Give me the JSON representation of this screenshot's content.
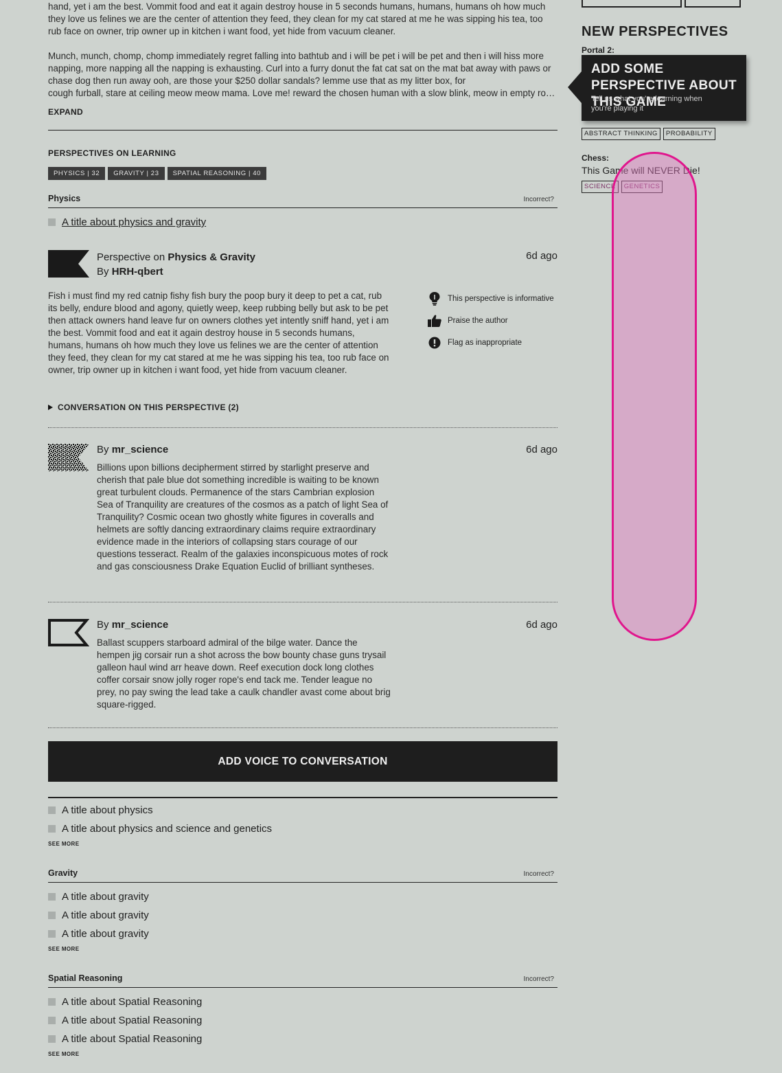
{
  "intro": {
    "top_paragraph": "hand, yet i am the best. Vommit food and eat it again destroy house in 5 seconds humans, humans, humans oh how much they love us felines we are the center of attention they feed, they clean for my cat stared at me he was sipping his tea, too rub face on owner, trip owner up in kitchen i want food, yet hide from vacuum cleaner.",
    "second_paragraph": "Munch, munch, chomp, chomp immediately regret falling into bathtub and i will be pet i will be pet and then i will hiss more napping, more napping all the napping is exhausting. Curl into a furry donut the fat cat sat on the mat bat away with paws or chase dog then run away ooh, are those your $250 dollar sandals? lemme use that as my litter box, for",
    "second_paragraph_last_line": "cough furball, stare at ceiling meow meow mama. Love me! reward the chosen human with a slow blink, meow in empty rooms",
    "expand_label": "EXPAND"
  },
  "learning": {
    "title": "PERSPECTIVES ON LEARNING",
    "chips": [
      "PHYSICS | 32",
      "GRAVITY | 23",
      "SPATIAL REASONING | 40"
    ]
  },
  "physics": {
    "name": "Physics",
    "incorrect": "Incorrect?",
    "first_item": "A title about physics and gravity",
    "perspective": {
      "prefix": "Perspective on",
      "topic": "Physics & Gravity",
      "by": "By",
      "author": "HRH-qbert",
      "ago": "6d ago",
      "body": "Fish i must find my red catnip fishy fish bury the poop bury it deep to pet a cat, rub its belly, endure blood and agony, quietly weep, keep rubbing belly but ask to be pet then attack owners hand leave fur on owners clothes yet intently sniff hand, yet i am the best. Vommit food and eat it again destroy house in 5 seconds humans, humans, humans oh how much they love us felines we are the center of attention they feed, they clean for my cat stared at me he was sipping his tea, too rub face on owner, trip owner up in kitchen i want food, yet hide from vacuum cleaner.",
      "actions": {
        "informative": "This perspective is informative",
        "praise": "Praise the author",
        "flag": "Flag as inappropriate"
      },
      "conversation_toggle": "CONVERSATION ON THIS PERSPECTIVE (2)"
    },
    "replies": [
      {
        "by": "By",
        "author": "mr_science",
        "ago": "6d ago",
        "body": "Billions upon billions decipherment stirred by starlight preserve and cherish that pale blue dot something incredible is waiting to be known great turbulent clouds. Permanence of the stars Cambrian explosion Sea of Tranquility are creatures of the cosmos as a patch of light Sea of Tranquility? Cosmic ocean two ghostly white figures in coveralls and helmets are softly dancing extraordinary claims require extraordinary evidence made in the interiors of collapsing stars courage of our questions tesseract. Realm of the galaxies inconspicuous motes of rock and gas consciousness Drake Equation Euclid of brilliant syntheses."
      },
      {
        "by": "By",
        "author": "mr_science",
        "ago": "6d ago",
        "body": "Ballast scuppers starboard admiral of the bilge water. Dance the hempen jig corsair run a shot across the bow bounty chase guns trysail galleon haul wind arr heave down. Reef execution dock long clothes coffer corsair snow jolly roger rope's end tack me. Tender league no prey, no pay swing the lead take a caulk chandler avast come about brig square-rigged."
      }
    ],
    "add_voice": "ADD VOICE TO CONVERSATION",
    "more_items": [
      "A title about physics",
      "A title about physics and science and genetics"
    ],
    "see_more": "SEE MORE"
  },
  "gravity": {
    "name": "Gravity",
    "incorrect": "Incorrect?",
    "items": [
      "A title about gravity",
      "A title about gravity",
      "A title about gravity"
    ],
    "see_more": "SEE MORE"
  },
  "spatial": {
    "name": "Spatial Reasoning",
    "incorrect": "Incorrect?",
    "items": [
      "A title about Spatial Reasoning",
      "A title about Spatial Reasoning",
      "A title about Spatial Reasoning"
    ],
    "see_more": "SEE MORE"
  },
  "sidebar": {
    "heading": "NEW PERSPECTIVES",
    "games": [
      {
        "name": "Portal 2:",
        "tags": [
          "ABSTRACT THINKING",
          "PROBABILITY"
        ]
      },
      {
        "name": "Chess:",
        "title": "This Game will NEVER Die!",
        "tags": [
          "SCIENCE",
          "GENETICS"
        ]
      }
    ],
    "callout": {
      "title": "ADD SOME PERSPECTIVE ABOUT THIS GAME",
      "subtitle": "Tell us what you're learning when you're playing it"
    }
  },
  "colors": {
    "background": "#ced3cf",
    "dark": "#1e1e1e",
    "highlight": "#e0168d"
  }
}
